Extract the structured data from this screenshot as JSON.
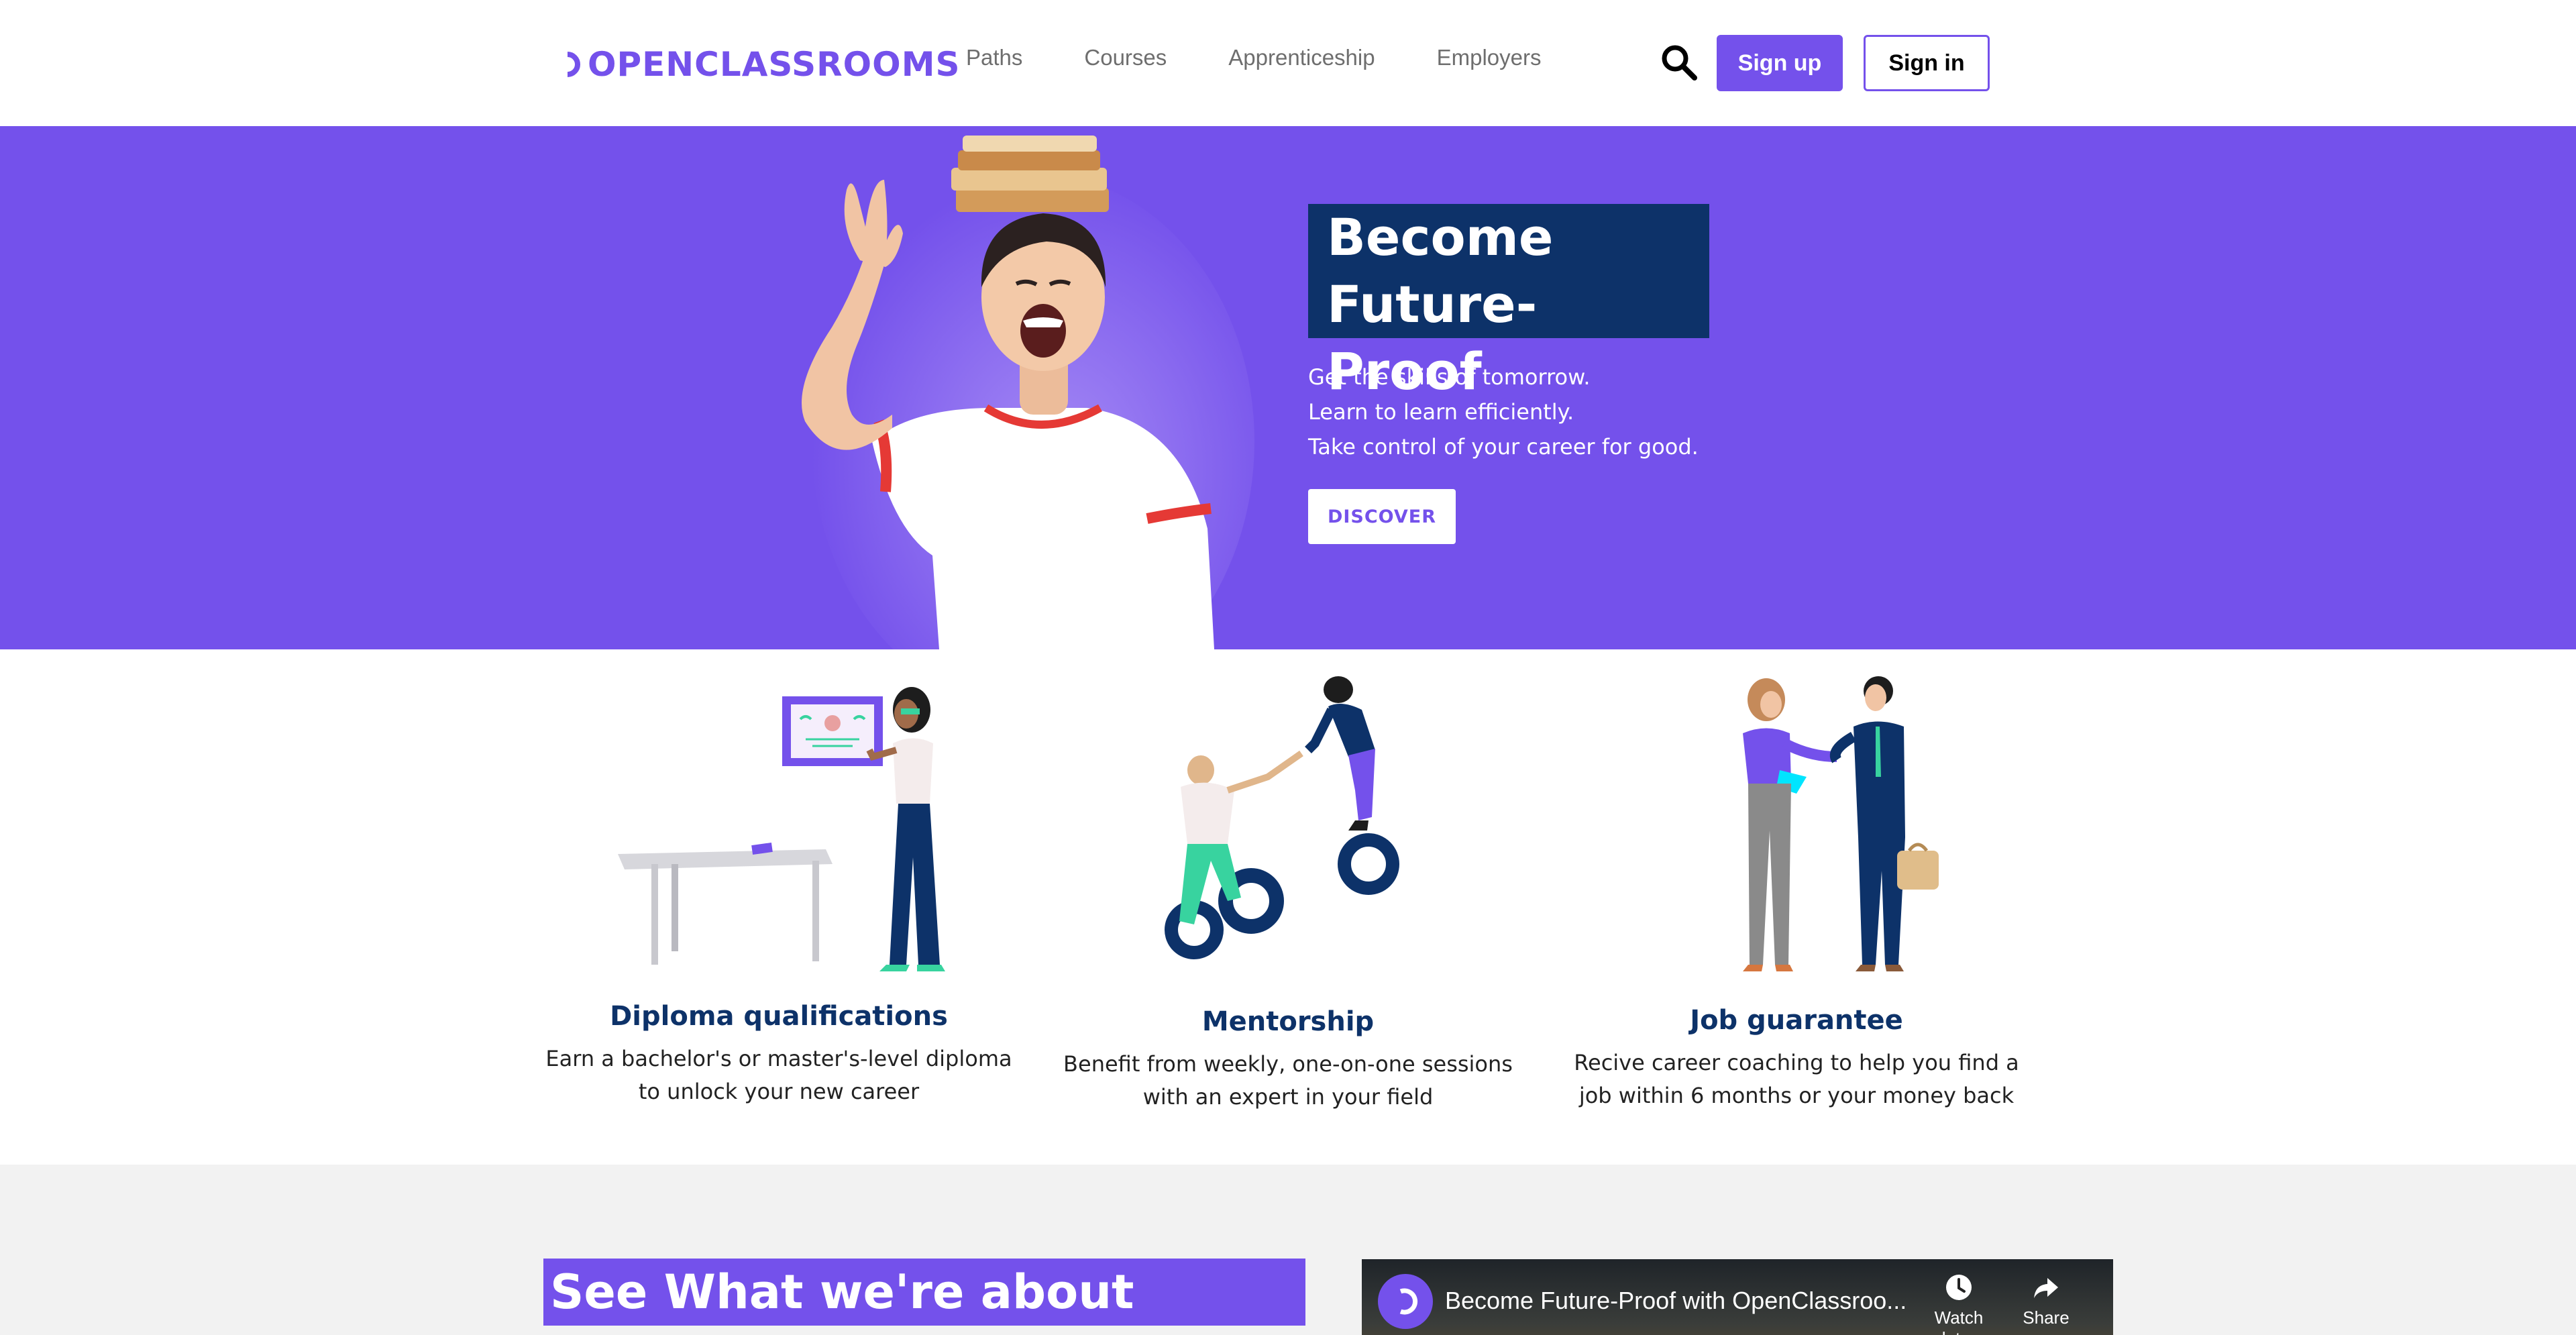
{
  "nav": {
    "logo_text": "OPENCLASSROOMS",
    "links": [
      "Paths",
      "Courses",
      "Apprenticeship",
      "Employers"
    ],
    "signup_label": "Sign up",
    "signin_label": "Sign in"
  },
  "hero": {
    "title_line1": "Become",
    "title_line2": "Future-Proof",
    "lines": [
      "Get the skills of tomorrow.",
      "Learn to learn efficiently.",
      "Take control of your career for good."
    ],
    "cta_label": "DISCOVER"
  },
  "features": [
    {
      "title": "Diploma qualifications",
      "desc1": "Earn a bachelor's or master's-level diploma",
      "desc2": "to unlock your new career"
    },
    {
      "title": "Mentorship",
      "desc1": "Benefit from weekly, one-on-one sessions",
      "desc2": "with an expert in your field"
    },
    {
      "title": "Job guarantee",
      "desc1": "Recive career coaching to help you find a",
      "desc2": "job within 6 months or your money back"
    }
  ],
  "about": {
    "title": "See What we're about",
    "video": {
      "title": "Become Future-Proof with OpenClassroo...",
      "watch_later_label": "Watch later",
      "share_label": "Share"
    }
  },
  "colors": {
    "brand_purple": "#7451eb",
    "navy": "#0d3269",
    "light_gray": "#f2f2f2"
  },
  "icons": [
    "openclassrooms-logo-icon",
    "search-icon",
    "clock-icon",
    "share-icon"
  ]
}
